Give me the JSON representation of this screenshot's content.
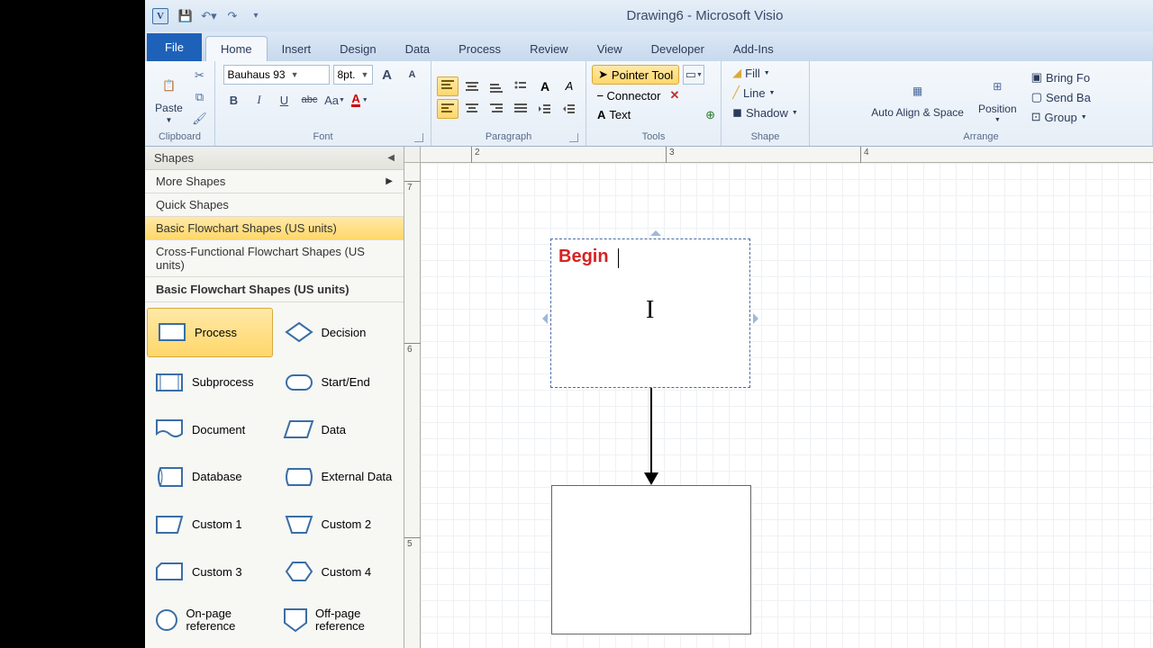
{
  "title": "Drawing6  -  Microsoft Visio",
  "tabs": {
    "file": "File",
    "items": [
      "Home",
      "Insert",
      "Design",
      "Data",
      "Process",
      "Review",
      "View",
      "Developer",
      "Add-Ins"
    ],
    "active": "Home"
  },
  "ribbon": {
    "clipboard": {
      "paste": "Paste",
      "label": "Clipboard"
    },
    "font": {
      "label": "Font",
      "name": "Bauhaus 93",
      "size": "8pt.",
      "grow": "A",
      "shrink": "A",
      "bold": "B",
      "italic": "I",
      "underline": "U",
      "strike": "abc",
      "case": "Aa",
      "color": "A"
    },
    "paragraph": {
      "label": "Paragraph"
    },
    "tools": {
      "label": "Tools",
      "pointer": "Pointer Tool",
      "connector": "Connector",
      "text": "Text"
    },
    "shape": {
      "label": "Shape",
      "fill": "Fill",
      "line": "Line",
      "shadow": "Shadow"
    },
    "arrange": {
      "label": "Arrange",
      "autoalign": "Auto Align & Space",
      "position": "Position",
      "bringf": "Bring Fo",
      "sendb": "Send Ba",
      "group": "Group"
    }
  },
  "shapes_pane": {
    "header": "Shapes",
    "more": "More Shapes",
    "quick": "Quick Shapes",
    "stencils": [
      "Basic Flowchart Shapes (US units)",
      "Cross-Functional Flowchart Shapes (US units)"
    ],
    "stencil_title": "Basic Flowchart Shapes (US units)",
    "items": [
      "Process",
      "Decision",
      "Subprocess",
      "Start/End",
      "Document",
      "Data",
      "Database",
      "External Data",
      "Custom 1",
      "Custom 2",
      "Custom 3",
      "Custom 4",
      "On-page reference",
      "Off-page reference"
    ]
  },
  "canvas": {
    "ruler_h": [
      "2",
      "3",
      "4"
    ],
    "ruler_v": [
      "7",
      "6",
      "5"
    ],
    "shape1_text": "Begin"
  }
}
